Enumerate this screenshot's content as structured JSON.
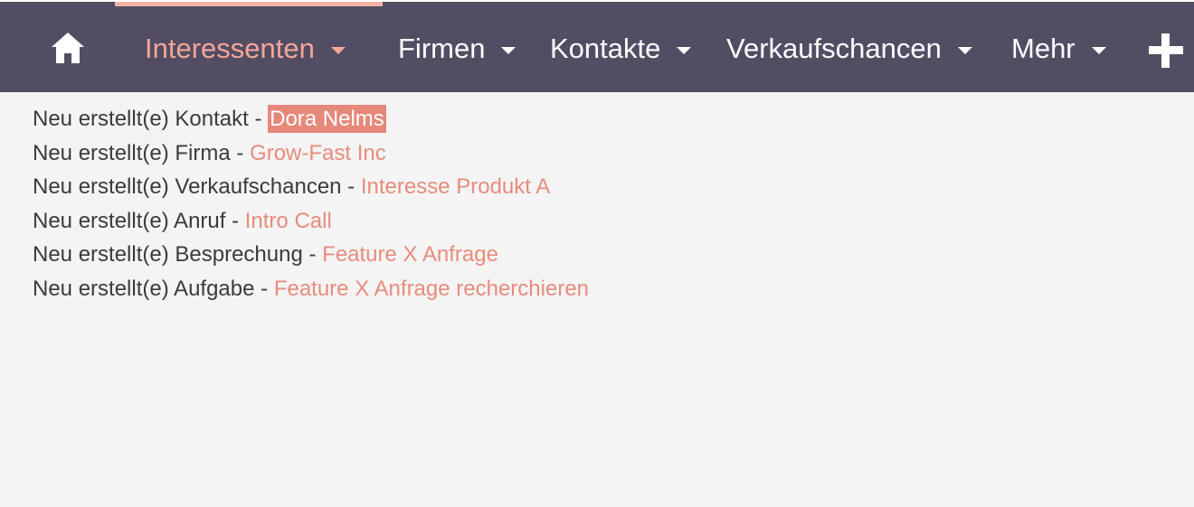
{
  "nav": {
    "items": [
      {
        "label": "Interessenten",
        "active": true
      },
      {
        "label": "Firmen",
        "active": false
      },
      {
        "label": "Kontakte",
        "active": false
      },
      {
        "label": "Verkaufschancen",
        "active": false
      },
      {
        "label": "Mehr",
        "active": false
      }
    ],
    "home_icon": "home-icon",
    "add_icon": "plus-icon"
  },
  "created_records": [
    {
      "prefix": "Neu erstellt(e) Kontakt - ",
      "link": "Dora Nelms",
      "highlighted": true
    },
    {
      "prefix": "Neu erstellt(e) Firma - ",
      "link": "Grow-Fast Inc",
      "highlighted": false
    },
    {
      "prefix": "Neu erstellt(e) Verkaufschancen - ",
      "link": "Interesse Produkt A",
      "highlighted": false
    },
    {
      "prefix": "Neu erstellt(e) Anruf - ",
      "link": "Intro Call",
      "highlighted": false
    },
    {
      "prefix": "Neu erstellt(e) Besprechung - ",
      "link": "Feature X Anfrage",
      "highlighted": false
    },
    {
      "prefix": "Neu erstellt(e) Aufgabe - ",
      "link": "Feature X Anfrage recherchieren",
      "highlighted": false
    }
  ],
  "colors": {
    "topbar": "#534d64",
    "accent": "#e88c7c",
    "active_nav": "#f4a698",
    "highlight_bg": "#e6887a",
    "background": "#f4f4f4"
  }
}
